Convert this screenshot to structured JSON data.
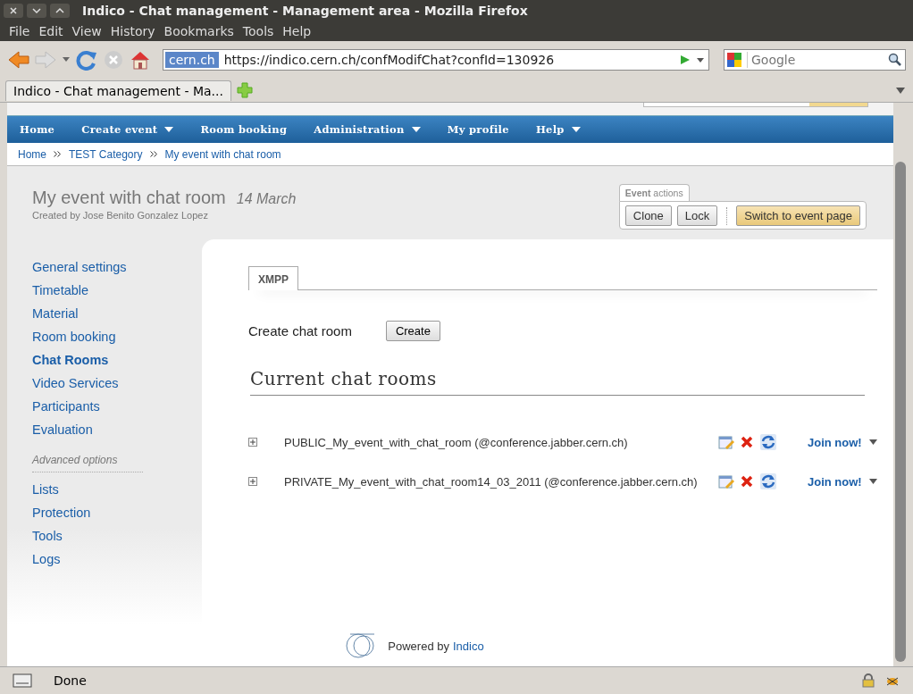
{
  "window": {
    "title": "Indico - Chat management - Management area - Mozilla Firefox"
  },
  "menu": [
    "File",
    "Edit",
    "View",
    "History",
    "Bookmarks",
    "Tools",
    "Help"
  ],
  "address_bar": {
    "domain": "cern.ch",
    "url": "https://indico.cern.ch/confModifChat?confId=130926"
  },
  "search": {
    "placeholder": "Google"
  },
  "browser_tabs": [
    {
      "label": "Indico - Chat management - Ma...",
      "selected": true
    }
  ],
  "nav": [
    {
      "label": "Home",
      "dropdown": false
    },
    {
      "label": "Create event",
      "dropdown": true
    },
    {
      "label": "Room booking",
      "dropdown": false
    },
    {
      "label": "Administration",
      "dropdown": true
    },
    {
      "label": "My profile",
      "dropdown": false
    },
    {
      "label": "Help",
      "dropdown": true
    }
  ],
  "breadcrumb": [
    "Home",
    "TEST Category",
    "My event with chat room"
  ],
  "event": {
    "title": "My event with chat room",
    "date": "14 March",
    "created_by": "Created by Jose Benito Gonzalez Lopez"
  },
  "event_actions": {
    "label": "**Event** actions",
    "buttons": [
      {
        "label": "Clone",
        "primary": false
      },
      {
        "label": "Lock",
        "primary": false
      },
      {
        "label": "Switch to event page",
        "primary": true
      }
    ]
  },
  "sidebar": [
    {
      "kind": "link",
      "label": "General settings",
      "selected": false
    },
    {
      "kind": "link",
      "label": "Timetable",
      "selected": false
    },
    {
      "kind": "link",
      "label": "Material",
      "selected": false
    },
    {
      "kind": "link",
      "label": "Room booking",
      "selected": false
    },
    {
      "kind": "link",
      "label": "Chat Rooms",
      "selected": true
    },
    {
      "kind": "link",
      "label": "Video Services",
      "selected": false
    },
    {
      "kind": "link",
      "label": "Participants",
      "selected": false
    },
    {
      "kind": "link",
      "label": "Evaluation",
      "selected": false
    },
    {
      "kind": "heading",
      "label": "Advanced options"
    },
    {
      "kind": "link",
      "label": "Lists",
      "selected": false
    },
    {
      "kind": "link",
      "label": "Protection",
      "selected": false
    },
    {
      "kind": "link",
      "label": "Tools",
      "selected": false
    },
    {
      "kind": "link",
      "label": "Logs",
      "selected": false
    }
  ],
  "content_tabs": [
    {
      "label": "XMPP",
      "selected": true
    }
  ],
  "create": {
    "label": "Create chat room",
    "button": "Create"
  },
  "rooms_heading": "Current chat rooms",
  "rooms": [
    {
      "name": "PUBLIC_My_event_with_chat_room (@conference.jabber.cern.ch)",
      "join": "Join now!"
    },
    {
      "name": "PRIVATE_My_event_with_chat_room14_03_2011 (@conference.jabber.cern.ch)",
      "join": "Join now!"
    }
  ],
  "footer": {
    "prefix": "Powered by",
    "link": "Indico"
  },
  "status_bar": {
    "text": "Done"
  }
}
